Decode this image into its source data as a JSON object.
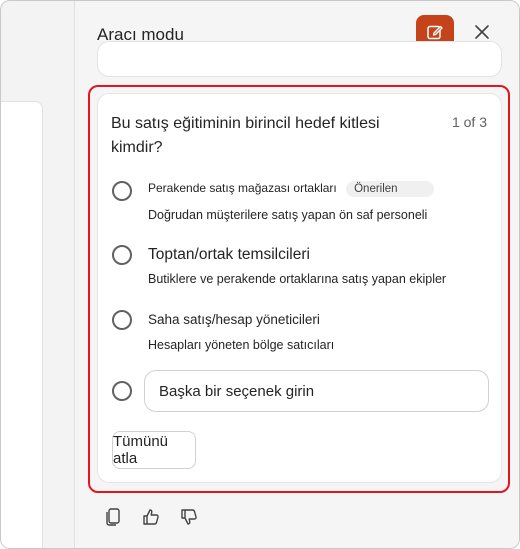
{
  "pane": {
    "title": "Aracı modu"
  },
  "question_card": {
    "question": "Bu satış eğitiminin birincil hedef kitlesi kimdir?",
    "pager": "1 of 3",
    "options": [
      {
        "title": "Perakende satış mağazası ortakları",
        "badge": "Önerilen",
        "description": "Doğrudan müşterilere satış yapan ön saf personeli"
      },
      {
        "title": "Toptan/ortak temsilcileri",
        "description": "Butiklere ve perakende ortaklarına satış yapan ekipler"
      },
      {
        "title": "Saha satış/hesap yöneticileri",
        "description": "Hesapları yöneten bölge satıcıları"
      }
    ],
    "custom_option_placeholder": "Başka bir seçenek girin",
    "skip_all_label": "Tümünü atla"
  },
  "icons": {
    "edit": "compose-icon",
    "close": "close-icon",
    "copy": "copy-icon",
    "like": "thumbs-up-icon",
    "dislike": "thumbs-down-icon"
  },
  "colors": {
    "accent": "#c4431b",
    "highlight": "#e5141e"
  }
}
